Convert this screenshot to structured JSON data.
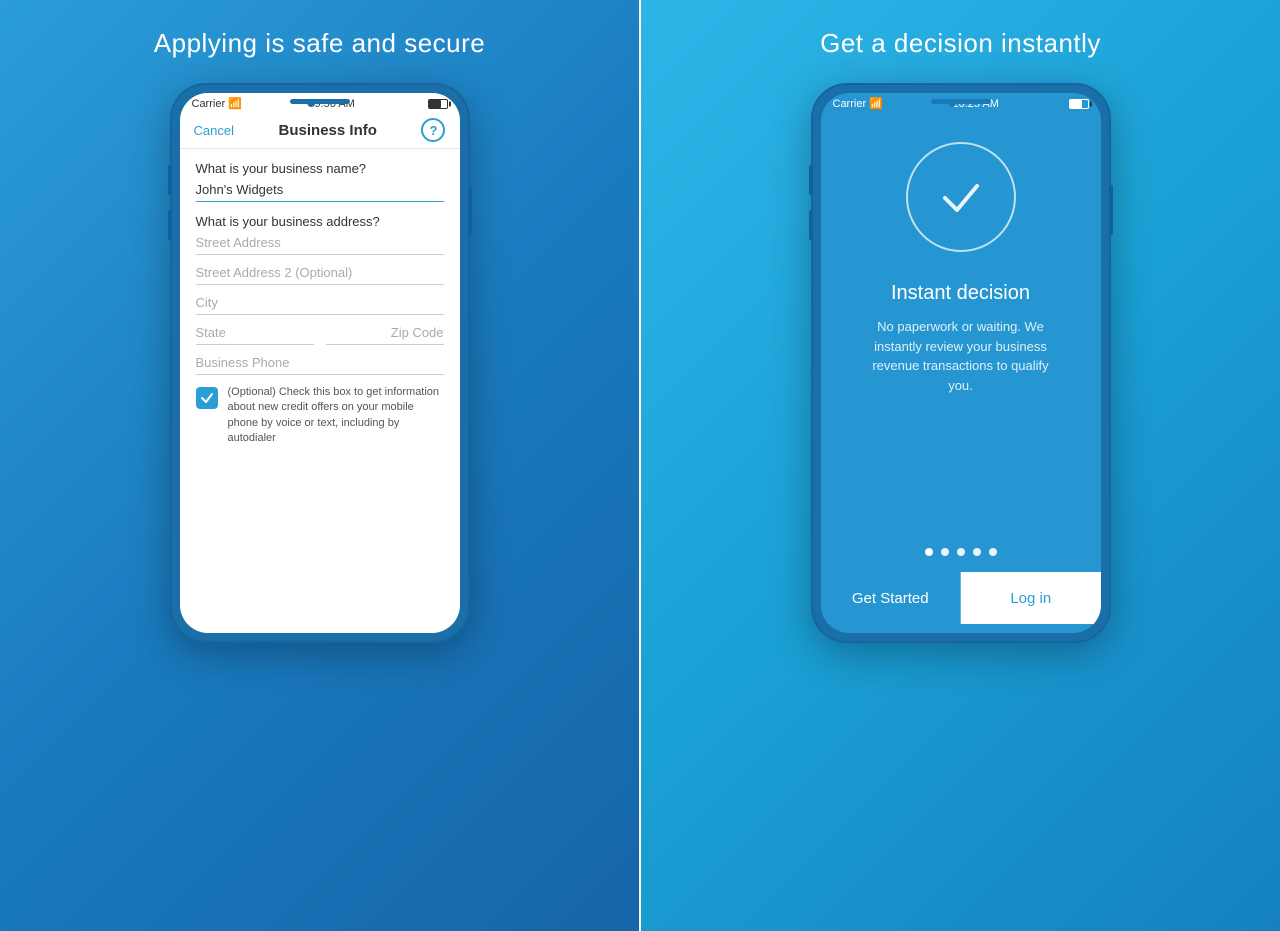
{
  "left_panel": {
    "title": "Applying is safe and secure",
    "phone": {
      "status_bar": {
        "carrier": "Carrier",
        "time": "9:56 AM"
      },
      "nav": {
        "cancel_label": "Cancel",
        "title": "Business Info",
        "help_icon": "?"
      },
      "form": {
        "business_name_label": "What is your business name?",
        "business_name_value": "John's Widgets",
        "address_label": "What is your business address?",
        "street_address_placeholder": "Street Address",
        "street_address2_placeholder": "Street Address 2 (Optional)",
        "city_placeholder": "City",
        "state_placeholder": "State",
        "zip_placeholder": "Zip Code",
        "phone_placeholder": "Business Phone",
        "checkbox_text": "(Optional) Check this box to get information about new credit offers on your mobile phone by voice or text, including by autodialer"
      }
    }
  },
  "right_panel": {
    "title": "Get a decision instantly",
    "phone": {
      "status_bar": {
        "carrier": "Carrier",
        "time": "10:25 AM"
      },
      "decision_title": "Instant decision",
      "decision_desc": "No paperwork or waiting. We instantly review your business revenue transactions to qualify you.",
      "dots_count": 5,
      "get_started_label": "Get Started",
      "login_label": "Log in"
    }
  }
}
